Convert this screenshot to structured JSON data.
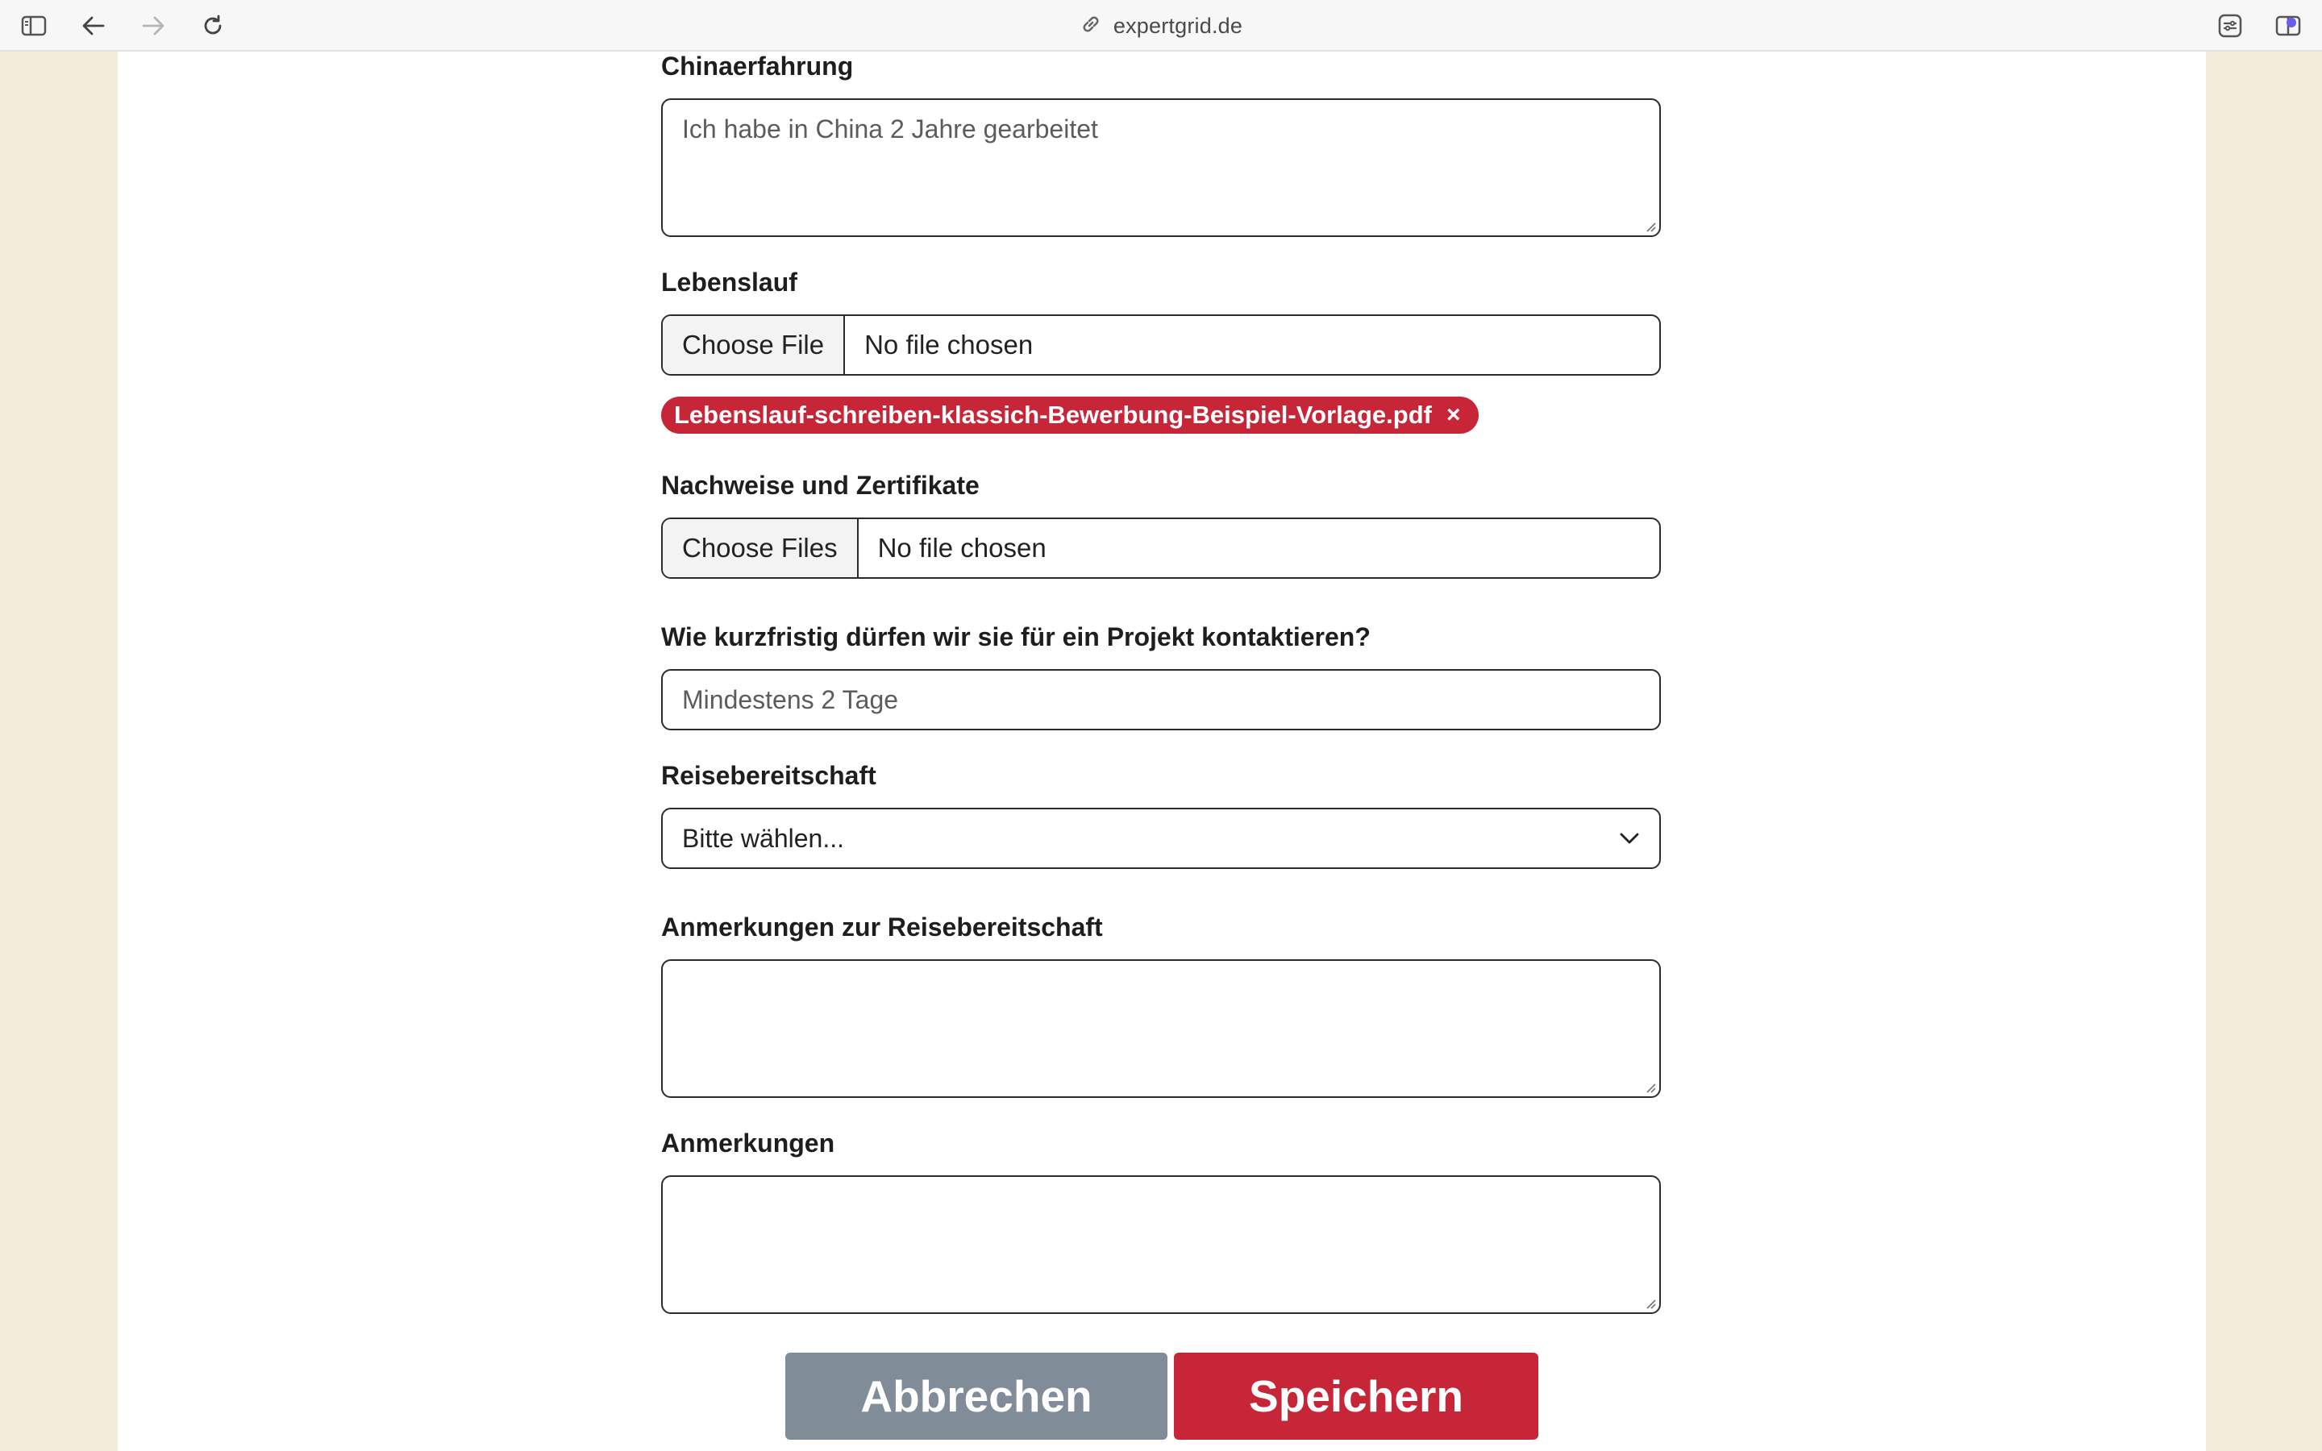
{
  "browser": {
    "url": "expertgrid.de"
  },
  "form": {
    "china": {
      "label": "Chinaerfahrung",
      "value": "Ich habe in China 2 Jahre gearbeitet"
    },
    "cv": {
      "label": "Lebenslauf",
      "button": "Choose File",
      "status": "No file chosen",
      "uploaded_file": "Lebenslauf-schreiben-klassich-Bewerbung-Beispiel-Vorlage.pdf",
      "remove_glyph": "×"
    },
    "certificates": {
      "label": "Nachweise und Zertifikate",
      "button": "Choose Files",
      "status": "No file chosen"
    },
    "contact": {
      "label": "Wie kurzfristig dürfen wir sie für ein Projekt kontaktieren?",
      "value": "Mindestens 2 Tage"
    },
    "travel": {
      "label": "Reisebereitschaft",
      "selected": "Bitte wählen..."
    },
    "travel_notes": {
      "label": "Anmerkungen zur Reisebereitschaft",
      "value": ""
    },
    "notes": {
      "label": "Anmerkungen",
      "value": ""
    }
  },
  "actions": {
    "cancel": "Abbrechen",
    "save": "Speichern"
  },
  "colors": {
    "accent": "#c62637",
    "secondary": "#818c99",
    "background": "#f3ecd9"
  }
}
